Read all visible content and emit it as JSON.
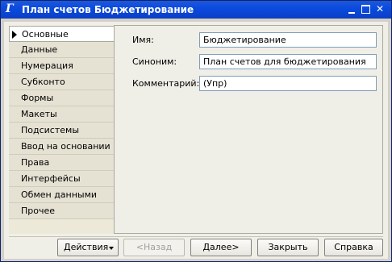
{
  "window": {
    "title": "План счетов Бюджетирование",
    "icon_label": "Г"
  },
  "nav": {
    "items": [
      {
        "label": "Основные",
        "active": true
      },
      {
        "label": "Данные"
      },
      {
        "label": "Нумерация"
      },
      {
        "label": "Субконто"
      },
      {
        "label": "Формы"
      },
      {
        "label": "Макеты"
      },
      {
        "label": "Подсистемы"
      },
      {
        "label": "Ввод на основании"
      },
      {
        "label": "Права"
      },
      {
        "label": "Интерфейсы"
      },
      {
        "label": "Обмен данными"
      },
      {
        "label": "Прочее"
      }
    ]
  },
  "form": {
    "name": {
      "label": "Имя:",
      "value": "Бюджетирование"
    },
    "synonym": {
      "label": "Синоним:",
      "value": "План счетов для бюджетирования"
    },
    "comment": {
      "label": "Комментарий:",
      "value": "(Упр)"
    }
  },
  "buttons": {
    "actions": "Действия",
    "back": "<Назад",
    "next": "Далее>",
    "close": "Закрыть",
    "help": "Справка"
  },
  "icons": {
    "title": "1c-config-icon",
    "minimize": "minimize-icon",
    "maximize": "maximize-icon",
    "close": "close-icon",
    "active_nav": "triangle-right-icon",
    "actions_dropdown": "chevron-down-icon"
  }
}
